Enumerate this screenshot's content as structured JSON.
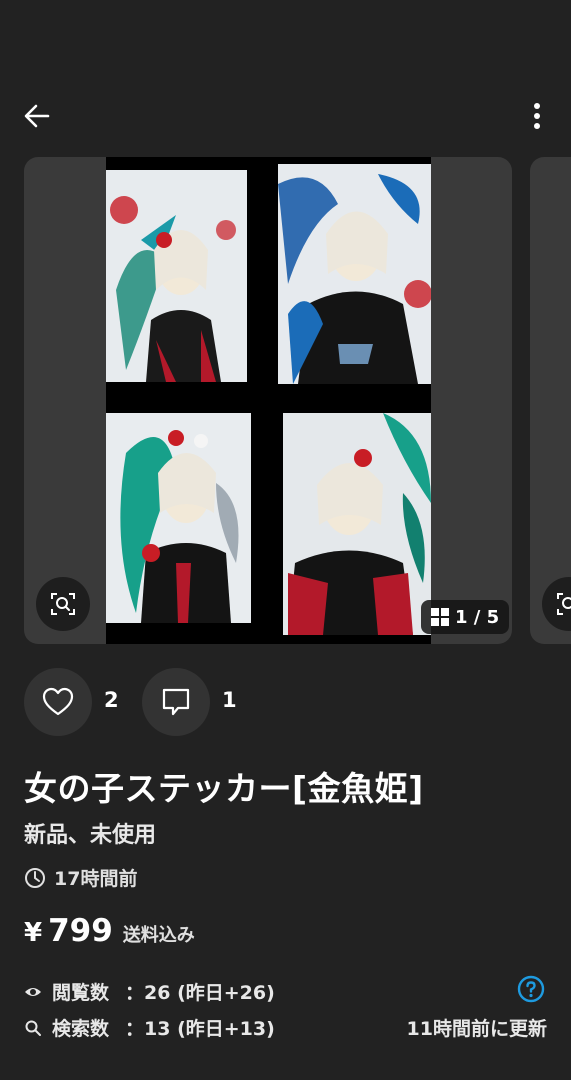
{
  "header": {
    "back_icon": "arrow-left-icon",
    "menu_icon": "more-vertical-icon"
  },
  "gallery": {
    "page_current": 1,
    "page_total": 5,
    "counter_label": "1 / 5",
    "lens_icon": "image-search-icon",
    "grid_icon": "grid-icon"
  },
  "actions": {
    "like_icon": "heart-icon",
    "like_count": "2",
    "comment_icon": "comment-icon",
    "comment_count": "1"
  },
  "item": {
    "title": "女の子ステッカー[金魚姫]",
    "condition": "新品、未使用",
    "posted_ago": "17時間前",
    "currency_symbol": "¥",
    "price": "799",
    "shipping_note": "送料込み"
  },
  "stats": {
    "views_label": "閲覧数",
    "views_value": "：26 (昨日+26)",
    "searches_label": "検索数",
    "searches_value": "：13 (昨日+13)",
    "updated": "11時間前に更新"
  },
  "colors": {
    "background": "#222222",
    "card": "#3a3a3a",
    "help_accent": "#1e9be0"
  }
}
